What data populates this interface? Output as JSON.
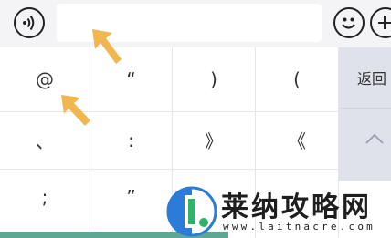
{
  "toolbar": {
    "voice_icon": "voice-input-icon",
    "input_value": "",
    "emoji_icon": "emoji-icon",
    "plus_icon": "plus-icon"
  },
  "keyboard": {
    "rows": [
      [
        "@",
        "“",
        ")",
        "("
      ],
      [
        "、",
        ":",
        "》",
        "《"
      ],
      [
        ";",
        "”",
        "",
        ""
      ]
    ],
    "back_label": "返回",
    "up_icon": "chevron-up-icon"
  },
  "watermark": {
    "title": "莱纳攻略网",
    "url": "www.laitnacre.com"
  },
  "colors": {
    "arrow": "#f2b64f",
    "bottom_strip": "#5ea893",
    "side_panel": "#dfe2ea"
  }
}
